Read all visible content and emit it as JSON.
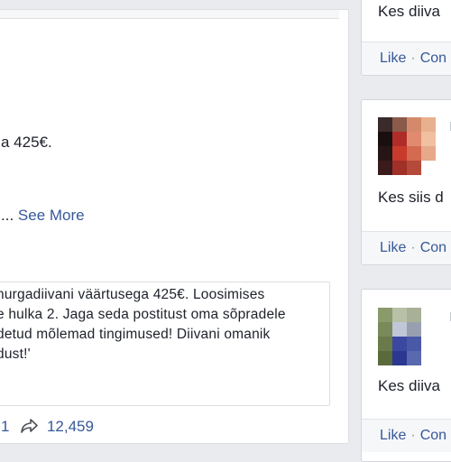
{
  "post": {
    "line_price": "a 425€.",
    "line_more_prefix": "...",
    "see_more": "See More",
    "quote_lines": [
      "nurgadiivani väärtusega 425€. Loosimises",
      "e hulka 2. Jaga seda postitust oma sõpradele",
      "detud mõlemad tingimused! Diivani omanik",
      "dust!'"
    ],
    "stats": {
      "count_fragment": "1",
      "share_count": "12,459"
    }
  },
  "sidebar": {
    "comments": [
      {
        "text": "Kes diiva",
        "like": "Like",
        "comment": "Con"
      },
      {
        "text": "Kes siis d",
        "like": "Like",
        "comment": "Con"
      },
      {
        "text": "Kes diiva",
        "like": "Like",
        "comment": "Con"
      }
    ]
  },
  "colors": {
    "link_blue": "#365899",
    "background": "#e9ebee"
  },
  "icons": {
    "share": "share-arrow-icon"
  }
}
